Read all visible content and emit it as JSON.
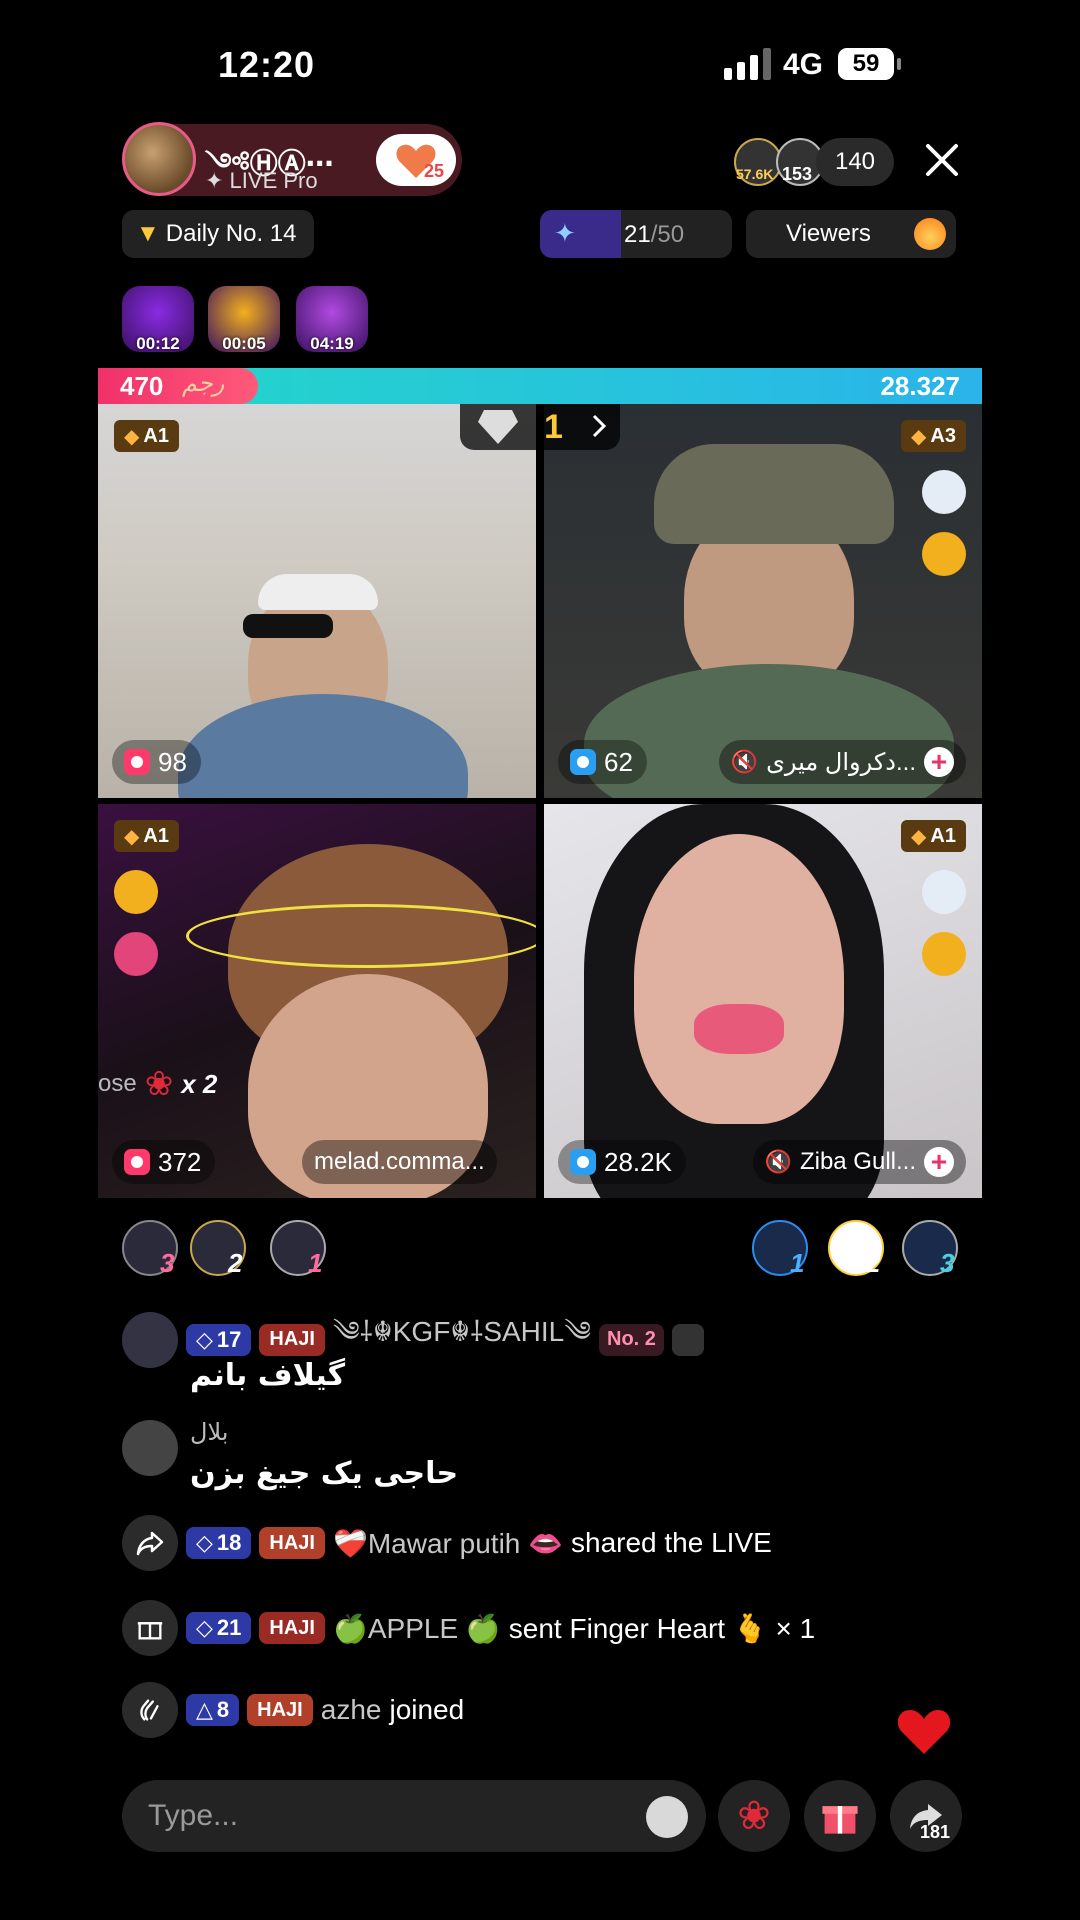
{
  "status_bar": {
    "time": "12:20",
    "network": "4G",
    "battery": "59"
  },
  "host": {
    "name": "༺ⒽⒶ⋯",
    "subtitle": "✦ LIVE Pro",
    "follow_count": "25"
  },
  "viewers": {
    "badge_1": "57.6K",
    "badge_2": "153",
    "count": "140"
  },
  "chips": {
    "daily": "Daily No. 14",
    "progress_current": "21",
    "progress_total": "/50",
    "progress_fraction": 0.42,
    "viewers_label": "Viewers"
  },
  "boosts": [
    {
      "time": "00:12",
      "color": "#8a2be2"
    },
    {
      "time": "00:05",
      "color": "#f2b01e"
    },
    {
      "time": "04:19",
      "color": "#b04ae0"
    }
  ],
  "battle": {
    "left_score": "470",
    "left_tag": "ﺭﺟﻢ",
    "right_score": "28.327",
    "win_streak": "1"
  },
  "tiles": [
    {
      "grade": "A1",
      "score": "98",
      "alarm_color": "#ff3a6a"
    },
    {
      "grade": "A3",
      "score": "62",
      "name": "دکروال میری...",
      "alarm_color": "#2a9ef0"
    },
    {
      "grade": "A1",
      "score": "372",
      "name": "melad.comma...",
      "alarm_color": "#ff3a6a"
    },
    {
      "grade": "A1",
      "score": "28.2K",
      "name": "Ziba Gull...",
      "alarm_color": "#2a9ef0"
    }
  ],
  "gift_float": {
    "text": "ose",
    "count": "x 2"
  },
  "supporters_left": [
    "3",
    "2",
    "1"
  ],
  "supporters_right": [
    "1",
    "2",
    "3"
  ],
  "chat": [
    {
      "level": "17",
      "badge": "HAJI",
      "user": "༄⸸☬KGF☬⸸SAHIL༄",
      "rank": "No. 2",
      "message": "گیلاف بانم"
    },
    {
      "user": "بلال",
      "message": "حاجی یک جیغ بزن"
    },
    {
      "level": "18",
      "badge": "HAJI",
      "user": "❤️‍🩹Mawar putih 👄",
      "message": "shared the LIVE"
    },
    {
      "level": "21",
      "badge": "HAJI",
      "user": "🍏APPLE 🍏",
      "message": "sent Finger Heart 🫰 × 1"
    },
    {
      "level": "8",
      "badge": "HAJI",
      "user": "azhe",
      "message": "joined"
    }
  ],
  "input": {
    "placeholder": "Type..."
  },
  "share_count": "181"
}
